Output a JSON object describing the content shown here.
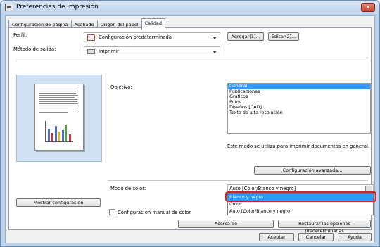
{
  "window": {
    "title": "Preferencias de impresión",
    "close_glyph": "✕"
  },
  "tabs": [
    "Configuración de página",
    "Acabado",
    "Origen del papel",
    "Calidad"
  ],
  "profile": {
    "label": "Perfil:",
    "value": "Configuración predeterminada",
    "add_button": "Agregar(1)...",
    "edit_button": "Editar(2)..."
  },
  "output": {
    "label": "Método de salida:",
    "value": "Imprimir"
  },
  "objective": {
    "label": "Objetivo:",
    "items": [
      "General",
      "Publicaciones",
      "Gráficos",
      "Fotos",
      "Diseños [CAD]",
      "Texto de alta resolución"
    ],
    "selected": 0,
    "description": "Este modo se utiliza para imprimir documentos en general."
  },
  "advanced_button": "Configuración avanzada...",
  "show_settings_button": "Mostrar configuración",
  "color_mode": {
    "label": "Modo de color:",
    "value": "Auto [Color/Blanco y negro]",
    "options": [
      "Blanco y negro",
      "Color",
      "Auto [Color/Blanco y negro]"
    ],
    "selected": 0
  },
  "manual_color": {
    "label": "Configuración manual de color",
    "checked": false
  },
  "about_button": "Acerca de",
  "restore_button": "Restaurar las opciones predeterminadas",
  "footer": {
    "ok": "Aceptar",
    "cancel": "Cancelar",
    "help": "Ayuda"
  },
  "colors": {
    "selection": "#3399ff",
    "highlight_border": "#d0202a",
    "preview_bg": "#cfe0f2"
  }
}
